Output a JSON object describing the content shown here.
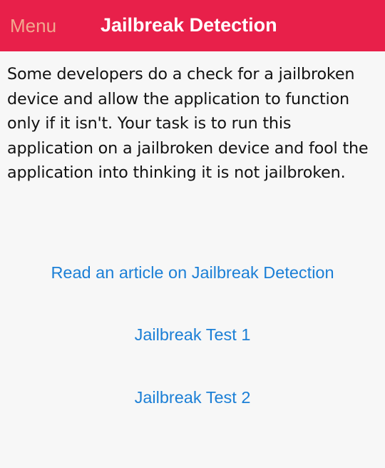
{
  "navbar": {
    "menu_label": "Menu",
    "title": "Jailbreak Detection",
    "background_color": "#e8204a"
  },
  "content": {
    "description": "Some developers do a check for a jailbroken device and allow the application to function only if it isn't. Your task is to run this application on a jailbroken device and fool the application into thinking it is not jailbroken."
  },
  "actions": {
    "article_link": "Read an article on Jailbreak Detection",
    "test1_button": "Jailbreak Test 1",
    "test2_button": "Jailbreak Test 2",
    "link_color": "#1b7fd6"
  }
}
